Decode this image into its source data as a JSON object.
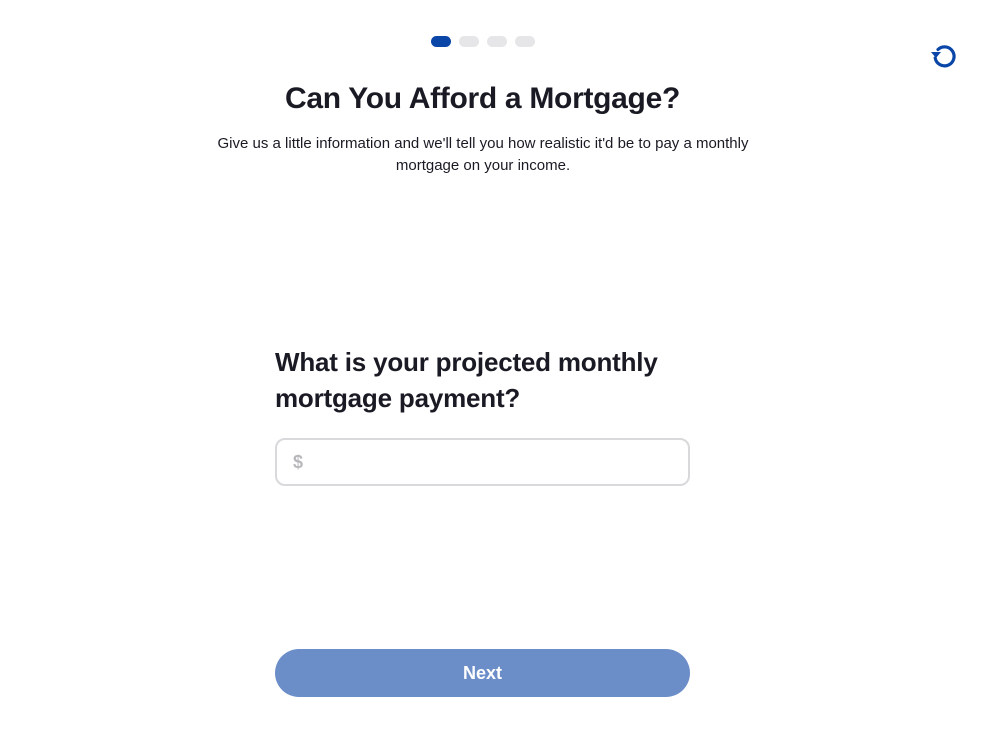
{
  "progress": {
    "total_steps": 4,
    "current_step": 1
  },
  "header": {
    "reset_icon": "reset-icon",
    "title": "Can You Afford a Mortgage?",
    "subtitle": "Give us a little information and we'll tell you how realistic it'd be to pay a monthly mortgage on your income."
  },
  "form": {
    "question": "What is your projected monthly mortgage payment?",
    "currency_symbol": "$",
    "amount_value": "",
    "amount_placeholder": ""
  },
  "actions": {
    "next_label": "Next"
  },
  "colors": {
    "accent": "#0a46a8",
    "button": "#6b8ec9",
    "inactive_dot": "#e6e6e8"
  }
}
